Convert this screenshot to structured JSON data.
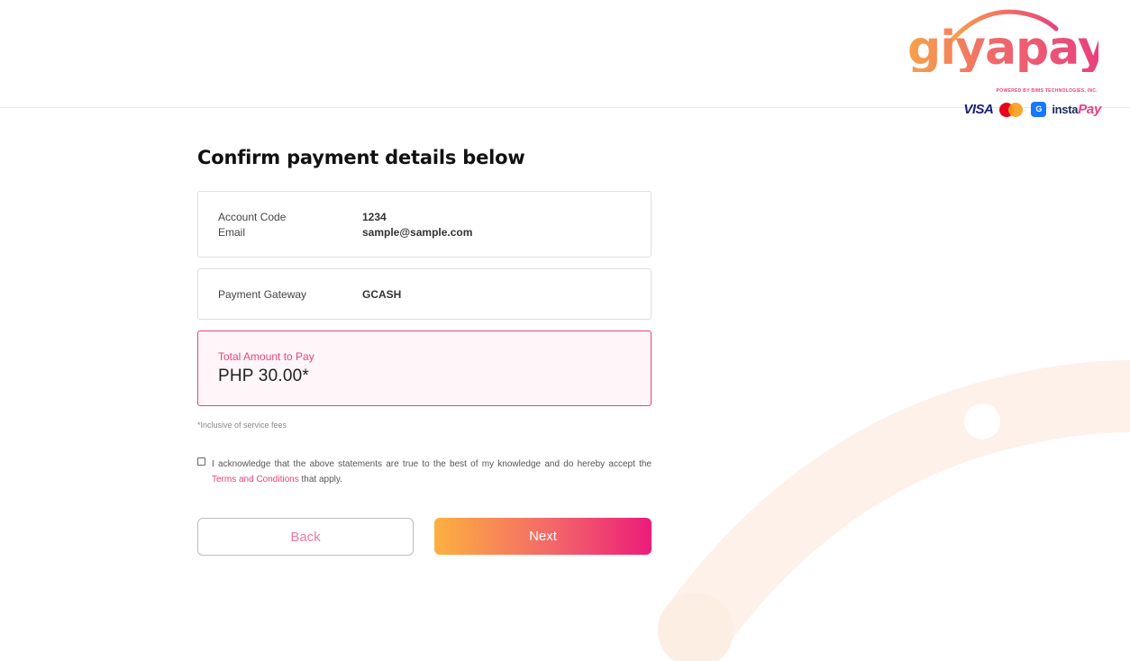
{
  "brand": {
    "logo_text": "giyapay",
    "powered_by": "POWERED BY BIMS TECHNOLOGIES, INC.",
    "payment_logos": {
      "visa": "VISA",
      "mastercard": "mastercard-logo",
      "gcash": "G",
      "instapay_prefix": "insta",
      "instapay_suffix": "Pay"
    },
    "colors": {
      "accent_pink": "#e8417f",
      "accent_orange": "#fcb040"
    }
  },
  "page": {
    "title": "Confirm payment details below"
  },
  "account": {
    "code_label": "Account Code",
    "code_value": "1234",
    "email_label": "Email",
    "email_value": "sample@sample.com"
  },
  "gateway": {
    "label": "Payment Gateway",
    "value": "GCASH"
  },
  "total": {
    "label": "Total Amount to Pay",
    "value": "PHP 30.00*"
  },
  "fee_note": "*Inclusive of service fees",
  "acknowledgement": {
    "checked": false,
    "text_before": "I acknowledge that the above statements are true to the best of my knowledge and do hereby accept the ",
    "terms_link": "Terms and Conditions",
    "text_after": " that apply."
  },
  "buttons": {
    "back": "Back",
    "next": "Next"
  }
}
